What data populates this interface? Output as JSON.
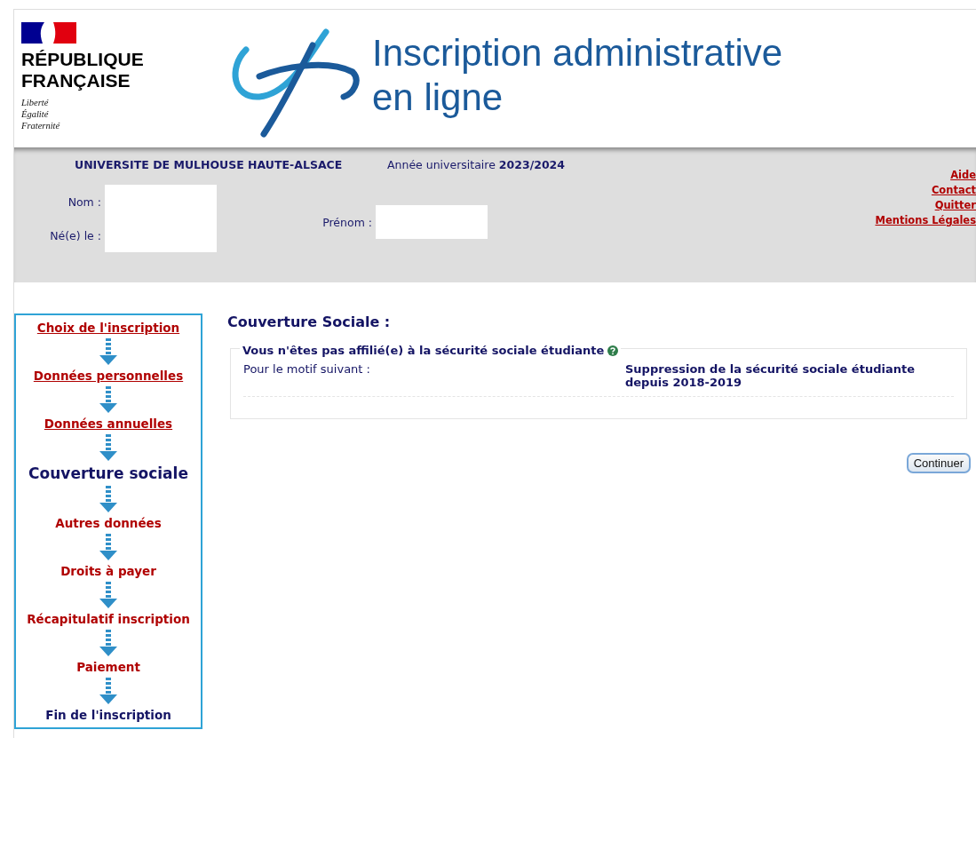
{
  "header": {
    "republic": {
      "name_lines": [
        "RÉPUBLIQUE",
        "FRANÇAISE"
      ],
      "motto": [
        "Liberté",
        "Égalité",
        "Fraternité"
      ]
    },
    "title_lines": [
      "Inscription administrative",
      "en ligne"
    ]
  },
  "info_bar": {
    "university": "UNIVERSITE DE MULHOUSE HAUTE-ALSACE",
    "year_label": "Année universitaire",
    "year": "2023/2024",
    "fields": [
      {
        "label": "Nom :",
        "hidden": true
      },
      {
        "label": "Né(e) le :",
        "hidden": true
      },
      {
        "label": "Prénom :",
        "hidden": true
      }
    ],
    "links": [
      "Aide",
      "Contact",
      "Quitter",
      "Mentions Légales"
    ]
  },
  "steps": [
    {
      "label": "Choix de l'inscription",
      "kind": "done"
    },
    {
      "label": "Données personnelles",
      "kind": "done"
    },
    {
      "label": "Données annuelles",
      "kind": "done"
    },
    {
      "label": "Couverture sociale",
      "kind": "current"
    },
    {
      "label": "Autres données",
      "kind": "todo"
    },
    {
      "label": "Droits à payer",
      "kind": "todo"
    },
    {
      "label": "Récapitulatif inscription",
      "kind": "todo"
    },
    {
      "label": "Paiement",
      "kind": "todo"
    },
    {
      "label": "Fin de l'inscription",
      "kind": "final"
    }
  ],
  "content": {
    "heading": "Couverture Sociale :",
    "fieldset": {
      "legend": "Vous n'êtes pas affilié(e) à la sécurité sociale étudiante",
      "label": "Pour le motif suivant :",
      "value": "Suppression de la sécurité sociale étudiante depuis 2018-2019"
    },
    "button": "Continuer"
  }
}
